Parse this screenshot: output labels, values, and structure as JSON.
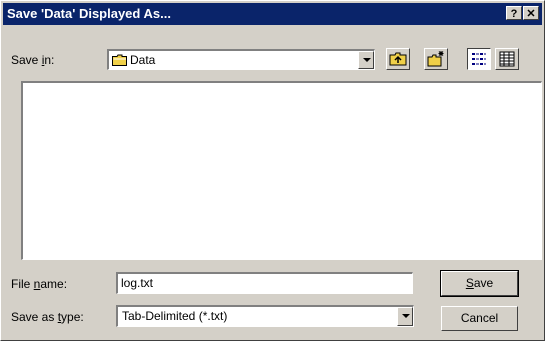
{
  "titlebar": {
    "title": "Save 'Data' Displayed As...",
    "help_label": "?",
    "close_label": "✕"
  },
  "save_in": {
    "label_prefix": "Save ",
    "label_accel": "i",
    "label_suffix": "n:",
    "value": "Data"
  },
  "toolbar": {
    "icons": [
      "up-one-level-icon",
      "create-new-folder-icon",
      "list-view-icon",
      "details-view-icon"
    ]
  },
  "file_name": {
    "label_prefix": "File ",
    "label_accel": "n",
    "label_suffix": "ame:",
    "value": "log.txt"
  },
  "save_as_type": {
    "label_prefix": "Save as ",
    "label_accel": "t",
    "label_suffix": "ype:",
    "value": "Tab-Delimited (*.txt)"
  },
  "buttons": {
    "save_accel": "S",
    "save_rest": "ave",
    "cancel": "Cancel"
  },
  "colors": {
    "title_bar": "#0a246a",
    "face": "#d4d0c8",
    "folder_yellow": "#f0d048"
  }
}
